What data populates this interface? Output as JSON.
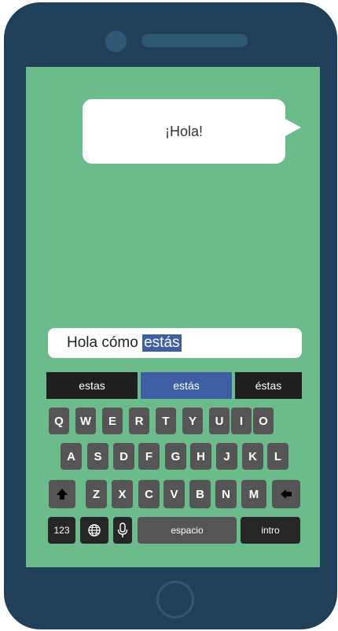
{
  "chat": {
    "message": "¡Hola!"
  },
  "input": {
    "text_before": "Hola cómo ",
    "selected_word": "estás"
  },
  "suggestions": [
    "estas",
    "estás",
    "éstas"
  ],
  "keyboard": {
    "row1": [
      "Q",
      "W",
      "E",
      "R",
      "T",
      "Y",
      "U",
      "I",
      "O"
    ],
    "row2": [
      "A",
      "S",
      "D",
      "F",
      "G",
      "H",
      "J",
      "K",
      "L"
    ],
    "row3": [
      "Z",
      "X",
      "C",
      "V",
      "B",
      "N",
      "M"
    ],
    "numbers_label": "123",
    "space_label": "espacio",
    "enter_label": "intro",
    "shift_icon": "shift-up-arrow-icon",
    "backspace_icon": "backspace-arrow-icon",
    "globe_icon": "globe-icon",
    "mic_icon": "microphone-icon"
  },
  "colors": {
    "phone_body": "#20405a",
    "screen": "#6cbb8b",
    "selection": "#3f5fa4",
    "key": "#555555",
    "key_dark": "#262626"
  }
}
